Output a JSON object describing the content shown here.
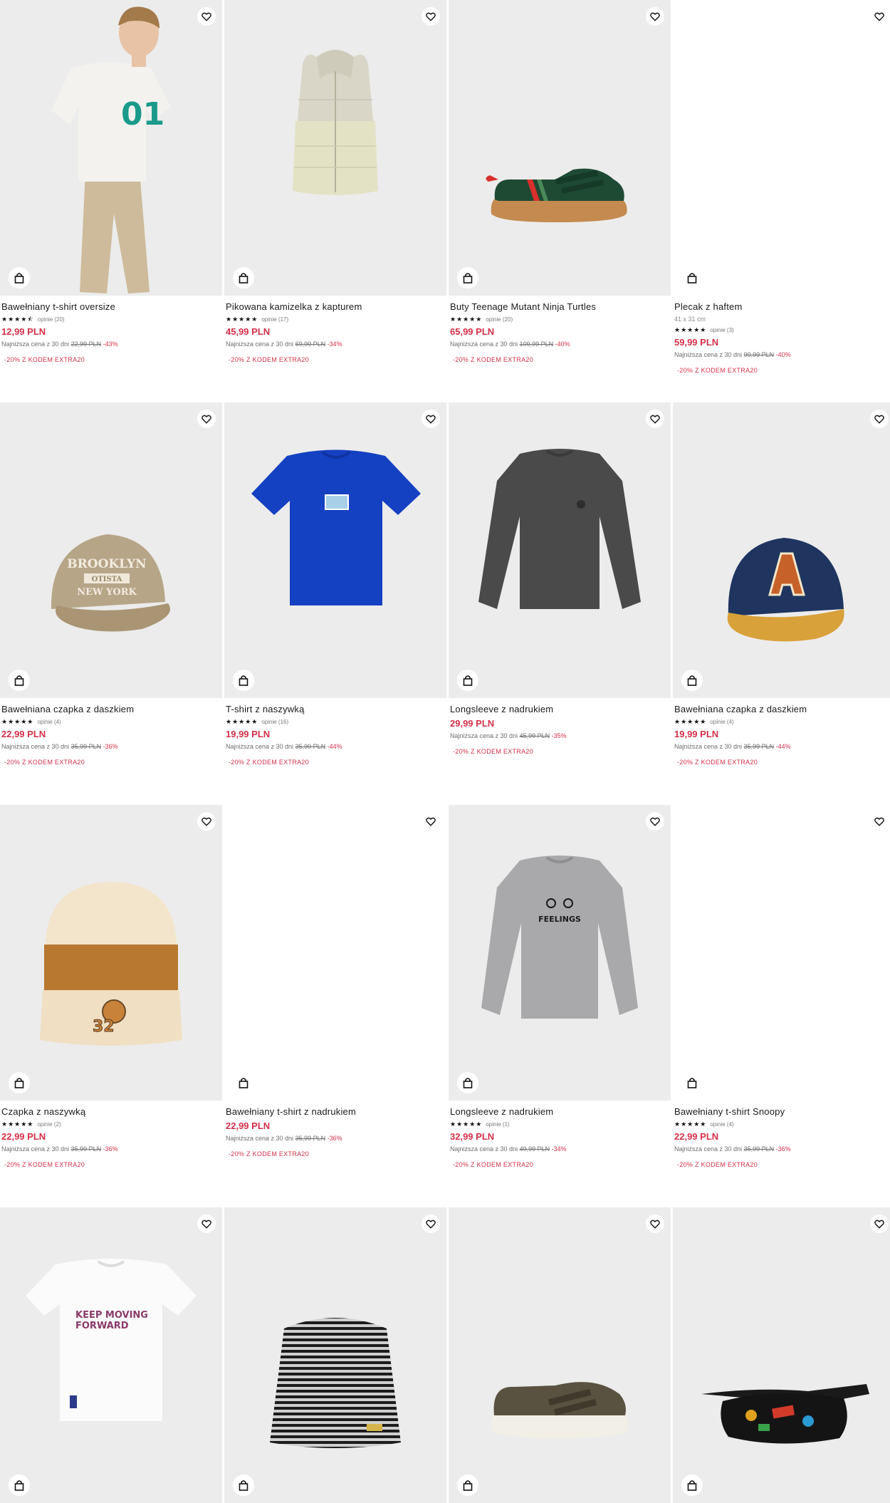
{
  "colors": {
    "accent": "#d4304a",
    "image_bg": "#ececec"
  },
  "icons": {
    "wishlist": "heart-icon",
    "cart": "shopping-bag-icon"
  },
  "products": [
    {
      "name": "Bawełniany t-shirt oversize",
      "rating_stars": "★★★★⯪",
      "reviews": "opinie (20)",
      "price": "12,99 PLN",
      "lowest_label": "Najniższa cena z 30 dni",
      "old_price": "22,99 PLN",
      "discount": "-43%",
      "promo": "-20% Z KODEM EXTRA20"
    },
    {
      "name": "Pikowana kamizelka z kapturem",
      "rating_stars": "★★★★★",
      "reviews": "opinie (17)",
      "price": "45,99 PLN",
      "lowest_label": "Najniższa cena z 30 dni",
      "old_price": "69,99 PLN",
      "discount": "-34%",
      "promo": "-20% Z KODEM EXTRA20"
    },
    {
      "name": "Buty Teenage Mutant Ninja Turtles",
      "rating_stars": "★★★★★",
      "reviews": "opinie (20)",
      "price": "65,99 PLN",
      "lowest_label": "Najniższa cena z 30 dni",
      "old_price": "109,99 PLN",
      "discount": "-40%",
      "promo": "-20% Z KODEM EXTRA20"
    },
    {
      "name": "Plecak z haftem",
      "dims": "41 x 31 cm",
      "rating_stars": "★★★★★",
      "reviews": "opinie (3)",
      "price": "59,99 PLN",
      "lowest_label": "Najniższa cena z 30 dni",
      "old_price": "99,99 PLN",
      "discount": "-40%",
      "promo": "-20% Z KODEM EXTRA20"
    },
    {
      "name": "Bawełniana czapka z daszkiem",
      "rating_stars": "★★★★★",
      "reviews": "opinie (4)",
      "price": "22,99 PLN",
      "lowest_label": "Najniższa cena z 30 dni",
      "old_price": "35,99 PLN",
      "discount": "-36%",
      "promo": "-20% Z KODEM EXTRA20"
    },
    {
      "name": "T-shirt z naszywką",
      "rating_stars": "★★★★★",
      "reviews": "opinie (16)",
      "price": "19,99 PLN",
      "lowest_label": "Najniższa cena z 30 dni",
      "old_price": "35,99 PLN",
      "discount": "-44%",
      "promo": "-20% Z KODEM EXTRA20"
    },
    {
      "name": "Longsleeve z nadrukiem",
      "price": "29,99 PLN",
      "lowest_label": "Najniższa cena z 30 dni",
      "old_price": "45,99 PLN",
      "discount": "-35%",
      "promo": "-20% Z KODEM EXTRA20"
    },
    {
      "name": "Bawełniana czapka z daszkiem",
      "rating_stars": "★★★★★",
      "reviews": "opinie (4)",
      "price": "19,99 PLN",
      "lowest_label": "Najniższa cena z 30 dni",
      "old_price": "35,99 PLN",
      "discount": "-44%",
      "promo": "-20% Z KODEM EXTRA20"
    },
    {
      "name": "Czapka z naszywką",
      "rating_stars": "★★★★★",
      "reviews": "opinie (2)",
      "price": "22,99 PLN",
      "lowest_label": "Najniższa cena z 30 dni",
      "old_price": "35,99 PLN",
      "discount": "-36%",
      "promo": "-20% Z KODEM EXTRA20"
    },
    {
      "name": "Bawełniany t-shirt z nadrukiem",
      "price": "22,99 PLN",
      "lowest_label": "Najniższa cena z 30 dni",
      "old_price": "35,99 PLN",
      "discount": "-36%",
      "promo": "-20% Z KODEM EXTRA20"
    },
    {
      "name": "Longsleeve z nadrukiem",
      "rating_stars": "★★★★★",
      "reviews": "opinie (1)",
      "price": "32,99 PLN",
      "lowest_label": "Najniższa cena z 30 dni",
      "old_price": "49,99 PLN",
      "discount": "-34%",
      "promo": "-20% Z KODEM EXTRA20"
    },
    {
      "name": "Bawełniany t-shirt Snoopy",
      "rating_stars": "★★★★★",
      "reviews": "opinie (4)",
      "price": "22,99 PLN",
      "lowest_label": "Najniższa cena z 30 dni",
      "old_price": "35,99 PLN",
      "discount": "-36%",
      "promo": "-20% Z KODEM EXTRA20"
    }
  ],
  "image_text": {
    "cap_brooklyn": [
      "BROOKLYN",
      "OTISTA",
      "NEW YORK"
    ],
    "tshirt_print": [
      "KEEP MOVING",
      "FORWARD"
    ],
    "longsleeve_print": "FEELINGS"
  }
}
